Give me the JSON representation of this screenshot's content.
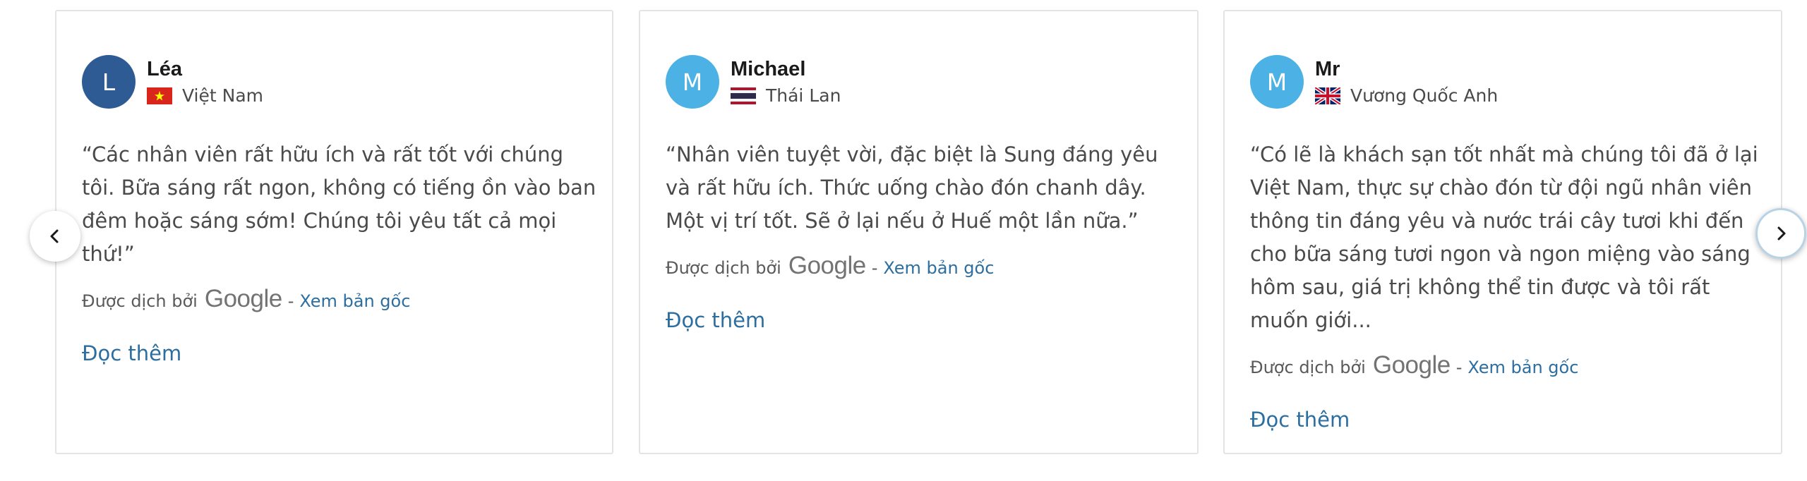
{
  "colors": {
    "link": "#2c6ea0",
    "avatar_dark": "#2f5b95",
    "avatar_light": "#4cb1e4"
  },
  "reviews": [
    {
      "initial": "L",
      "name": "Léa",
      "country": "Việt Nam",
      "flag_icon": "vietnam-flag-icon",
      "text": "“Các nhân viên rất hữu ích và rất tốt với chúng tôi. Bữa sáng rất ngon, không có tiếng ồn vào ban đêm hoặc sáng sớm! Chúng tôi yêu tất cả mọi thứ!”",
      "translated_by": "Được dịch bởi",
      "google": "Google",
      "dash": "-",
      "view_original": "Xem bản gốc",
      "read_more": "Đọc thêm"
    },
    {
      "initial": "M",
      "name": "Michael",
      "country": "Thái Lan",
      "flag_icon": "thailand-flag-icon",
      "text": "“Nhân viên tuyệt vời, đặc biệt là Sung đáng yêu và rất hữu ích. Thức uống chào đón chanh dây. Một vị trí tốt. Sẽ ở lại nếu ở Huế một lần nữa.”",
      "translated_by": "Được dịch bởi",
      "google": "Google",
      "dash": "-",
      "view_original": "Xem bản gốc",
      "read_more": "Đọc thêm"
    },
    {
      "initial": "M",
      "name": "Mr",
      "country": "Vương Quốc Anh",
      "flag_icon": "uk-flag-icon",
      "text": "“Có lẽ là khách sạn tốt nhất mà chúng tôi đã ở lại Việt Nam, thực sự chào đón từ đội ngũ nhân viên thông tin đáng yêu và nước trái cây tươi khi đến cho bữa sáng tươi ngon và ngon miệng vào sáng hôm sau, giá trị không thể tin được và tôi rất muốn giới...",
      "translated_by": "Được dịch bởi",
      "google": "Google",
      "dash": "-",
      "view_original": "Xem bản gốc",
      "read_more": "Đọc thêm"
    }
  ],
  "nav": {
    "prev_icon": "chevron-left-icon",
    "next_icon": "chevron-right-icon"
  }
}
